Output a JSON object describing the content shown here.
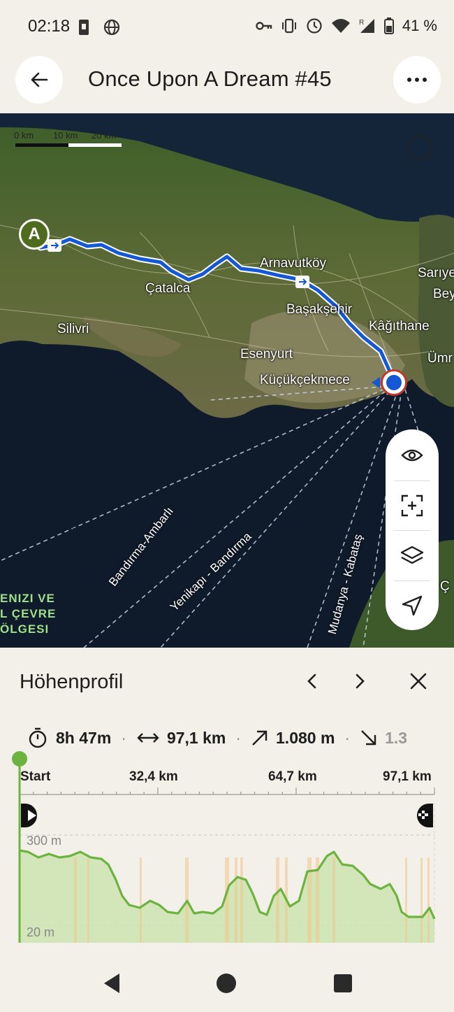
{
  "status_bar": {
    "time": "02:18",
    "battery": "41 %"
  },
  "header": {
    "title": "Once Upon A Dream #45",
    "back_icon": "arrow-left-icon",
    "more_icon": "more-horizontal-icon"
  },
  "map": {
    "scale": {
      "labels": [
        "0 km",
        "10 km",
        "20 km"
      ]
    },
    "start_marker": "A",
    "place_labels": [
      "Arnavutköy",
      "Çatalca",
      "Başakşehir",
      "Kâğıthane",
      "Silivri",
      "Esenyurt",
      "Küçükçekmece",
      "Sarıye",
      "Bey",
      "Ümr"
    ],
    "ferry_labels": [
      "Bandırma-Ambarlı",
      "Yenikapı - Bandırma",
      "Mudanya - Kabataş"
    ],
    "region_lines": [
      "ENIZI VE",
      "L ÇEVRE",
      "ÖLGESI"
    ],
    "cut_label": "Ç",
    "route_color": "#1558d6",
    "controls": [
      "eye-icon",
      "fit-route-icon",
      "layers-icon",
      "navigate-icon"
    ]
  },
  "profile": {
    "title": "Höhenprofil",
    "stats": {
      "duration": "8h 47m",
      "distance": "97,1 km",
      "ascent": "1.080 m",
      "descent": "1.3"
    },
    "axis": {
      "start": "Start",
      "km1": "32,4 km",
      "km2": "64,7 km",
      "km3": "97,1 km"
    },
    "y_labels": {
      "top": "300 m",
      "bottom": "20 m"
    },
    "line_color": "#6cb33f"
  }
}
